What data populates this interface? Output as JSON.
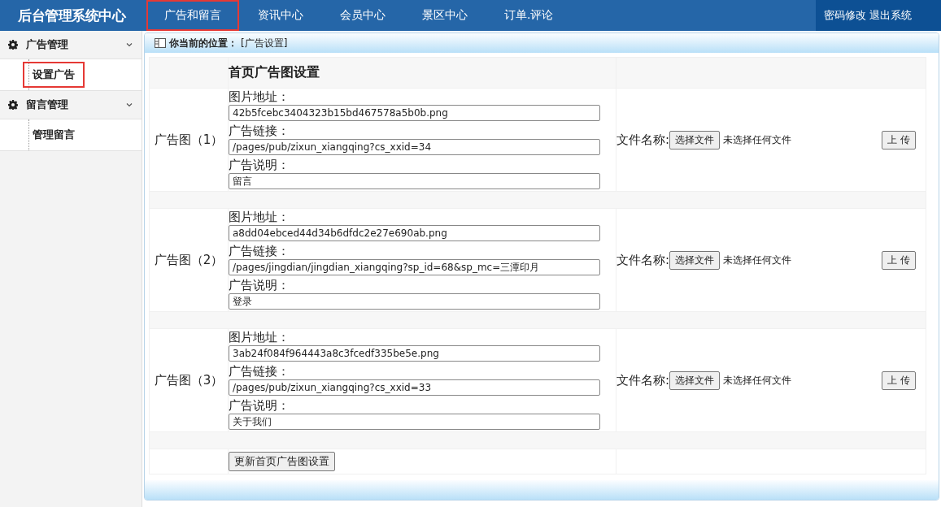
{
  "header": {
    "title": "后台管理系统中心",
    "nav": [
      {
        "label": "广告和留言",
        "selected": true
      },
      {
        "label": "资讯中心",
        "selected": false
      },
      {
        "label": "会员中心",
        "selected": false
      },
      {
        "label": "景区中心",
        "selected": false
      },
      {
        "label": "订单.评论",
        "selected": false
      }
    ],
    "links": [
      "密码修改",
      "退出系统"
    ]
  },
  "sidebar": {
    "groups": [
      {
        "label": "广告管理",
        "expanded": true,
        "items": [
          {
            "label": "设置广告",
            "selected": true
          }
        ]
      },
      {
        "label": "留言管理",
        "expanded": true,
        "items": [
          {
            "label": "管理留言",
            "selected": false
          }
        ]
      }
    ]
  },
  "breadcrumb": {
    "label": "你当前的位置：",
    "value": "[广告设置]"
  },
  "form": {
    "title": "首页广告图设置",
    "ads": [
      {
        "label": "广告图（1）",
        "fields": [
          {
            "label": "图片地址：",
            "value": "42b5fcebc3404323b15bd467578a5b0b.png"
          },
          {
            "label": "广告链接：",
            "value": "/pages/pub/zixun_xiangqing?cs_xxid=34"
          },
          {
            "label": "广告说明：",
            "value": "留言"
          }
        ],
        "file_label": "文件名称:",
        "choose_button": "选择文件",
        "file_status": "未选择任何文件",
        "upload_button": "上 传"
      },
      {
        "label": "广告图（2）",
        "fields": [
          {
            "label": "图片地址：",
            "value": "a8dd04ebced44d34b6dfdc2e27e690ab.png"
          },
          {
            "label": "广告链接：",
            "value": "/pages/jingdian/jingdian_xiangqing?sp_id=68&sp_mc=三潭印月"
          },
          {
            "label": "广告说明：",
            "value": "登录"
          }
        ],
        "file_label": "文件名称:",
        "choose_button": "选择文件",
        "file_status": "未选择任何文件",
        "upload_button": "上 传"
      },
      {
        "label": "广告图（3）",
        "fields": [
          {
            "label": "图片地址：",
            "value": "3ab24f084f964443a8c3fcedf335be5e.png"
          },
          {
            "label": "广告链接：",
            "value": "/pages/pub/zixun_xiangqing?cs_xxid=33"
          },
          {
            "label": "广告说明：",
            "value": "关于我们"
          }
        ],
        "file_label": "文件名称:",
        "choose_button": "选择文件",
        "file_status": "未选择任何文件",
        "upload_button": "上 传"
      }
    ],
    "submit": "更新首页广告图设置"
  }
}
